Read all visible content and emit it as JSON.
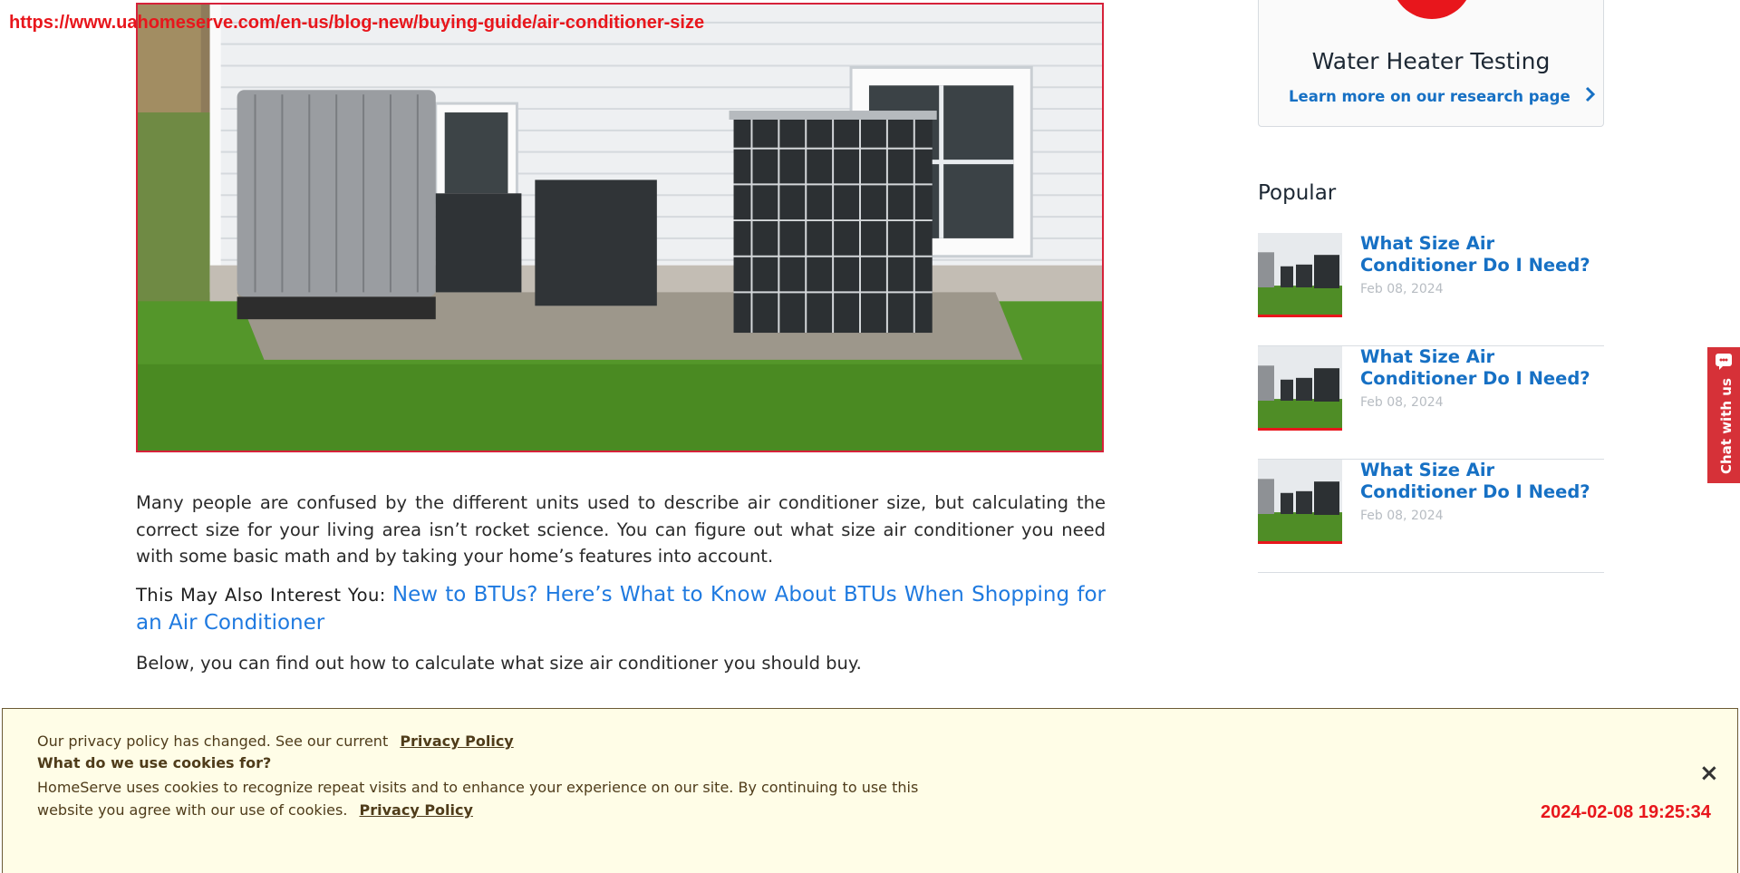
{
  "overlay": {
    "url": "https://www.uahomeserve.com/en-us/blog-new/buying-guide/air-conditioner-size",
    "timestamp": "2024-02-08 19:25:34"
  },
  "sidebar": {
    "card": {
      "title": "Water Heater Testing",
      "link": "Learn more on our research page"
    },
    "popular": {
      "heading": "Popular",
      "items": [
        {
          "title": "What Size Air Conditioner Do I Need?",
          "date": "Feb 08, 2024"
        },
        {
          "title": "What Size Air Conditioner Do I Need?",
          "date": "Feb 08, 2024"
        },
        {
          "title": "What Size Air Conditioner Do I Need?",
          "date": "Feb 08, 2024"
        }
      ]
    }
  },
  "article": {
    "intro": "Many people are confused by the different units used to describe air conditioner size, but calculating the correct size for your living area isn’t rocket science. You can figure out what size air conditioner you need with some basic math and by taking your home’s features into account.",
    "interest_lead": "This May Also Interest You:",
    "interest_link": "New to BTUs? Here’s What to Know About BTUs When Shopping for an Air Conditioner",
    "below": "Below, you can find out how to calculate what size air conditioner you should buy."
  },
  "chat": {
    "label": "Chat with us"
  },
  "cookie": {
    "line1": "Our privacy policy has changed. See our current",
    "privacy_link": "Privacy Policy",
    "heading": "What do we use cookies for?",
    "body": "HomeServe uses cookies to recognize repeat visits and to enhance your experience on our site. By continuing to use this website you agree with our use of cookies.",
    "close": "×"
  },
  "colors": {
    "accent_red": "#e8161c",
    "link_blue": "#1670c4",
    "cookie_bg": "#fffde7"
  }
}
